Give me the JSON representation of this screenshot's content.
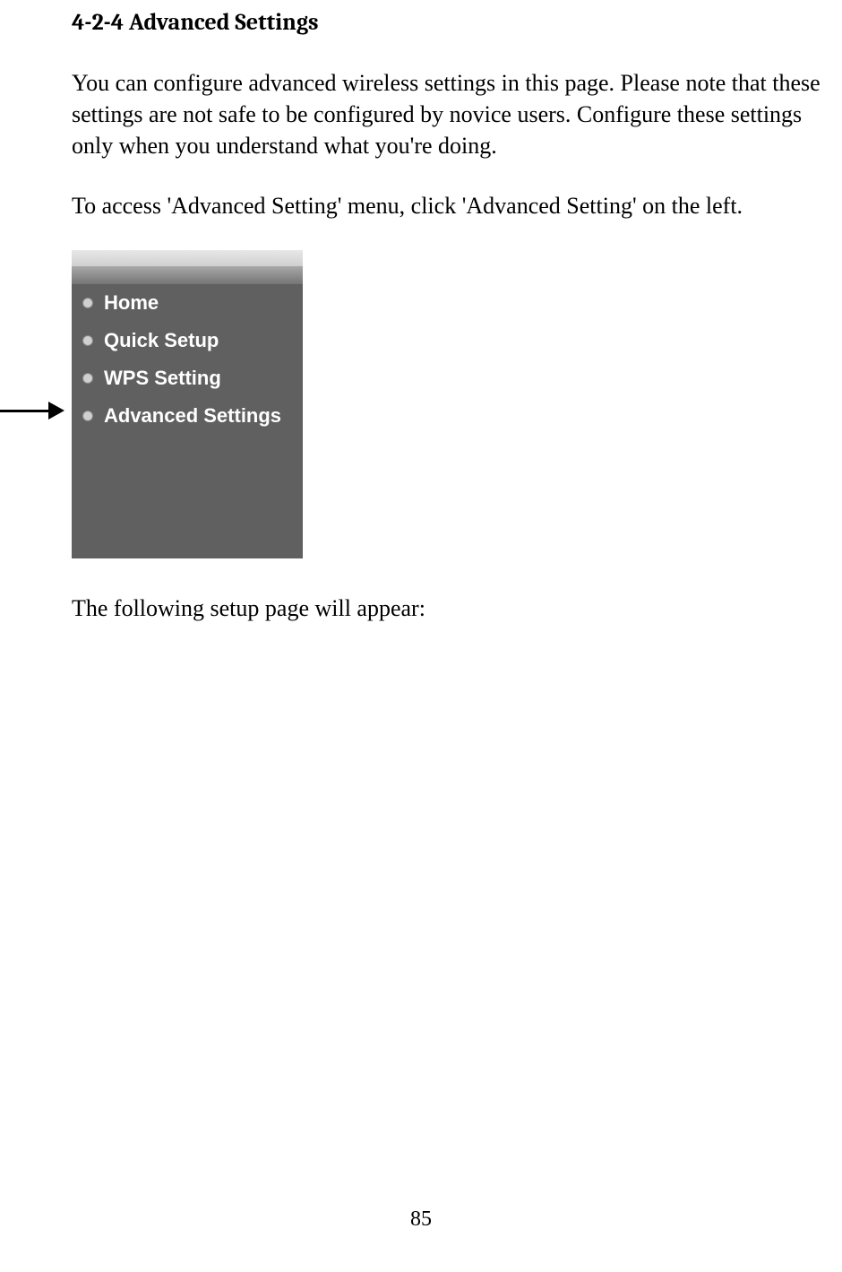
{
  "heading": "4-2-4 Advanced Settings",
  "para1": "You can configure advanced wireless settings in this page. Please note that these settings are not safe to be configured by novice users. Configure these settings only when you understand what you're doing.",
  "para2": "To access 'Advanced Setting' menu, click 'Advanced Setting' on the left.",
  "menu": {
    "items": [
      {
        "label": "Home"
      },
      {
        "label": "Quick Setup"
      },
      {
        "label": "WPS Setting"
      },
      {
        "label": "Advanced Settings"
      }
    ]
  },
  "para3": "The following setup page will appear:",
  "page_number": "85"
}
